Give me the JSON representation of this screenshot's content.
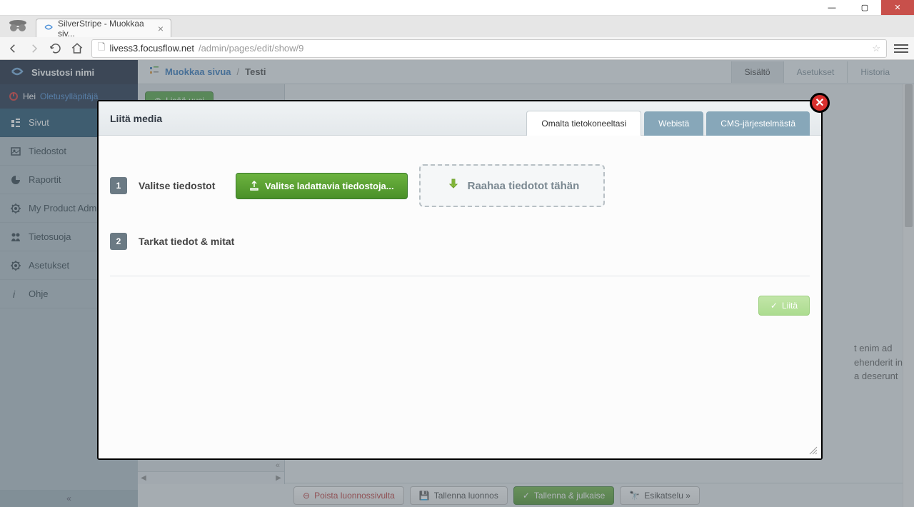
{
  "browser": {
    "tab_title": "SilverStripe - Muokkaa siv...",
    "url_domain": "livess3.focusflow.net",
    "url_path": "/admin/pages/edit/show/9"
  },
  "sidebar": {
    "site_name": "Sivustosi nimi",
    "greeting": "Hei",
    "user": "Oletusylläpitäjä",
    "items": [
      {
        "label": "Sivut"
      },
      {
        "label": "Tiedostot"
      },
      {
        "label": "Raportit"
      },
      {
        "label": "My Product Adm"
      },
      {
        "label": "Tietosuoja"
      },
      {
        "label": "Asetukset"
      },
      {
        "label": "Ohje"
      }
    ],
    "collapse": "«"
  },
  "breadcrumb": {
    "link": "Muokkaa sivua",
    "sep": "/",
    "current": "Testi",
    "tabs": [
      {
        "label": "Sisältö",
        "active": true
      },
      {
        "label": "Asetukset",
        "active": false
      },
      {
        "label": "Historia",
        "active": false
      }
    ]
  },
  "tree": {
    "add_label": "Lisää uusi",
    "collapse": "«"
  },
  "actions": {
    "delete": "Poista luonnossivulta",
    "save_draft": "Tallenna luonnos",
    "publish": "Tallenna & julkaise",
    "preview": "Esikatselu »"
  },
  "modal": {
    "title": "Liitä media",
    "tabs": [
      {
        "label": "Omalta tietokoneeltasi",
        "active": true
      },
      {
        "label": "Webistä",
        "active": false
      },
      {
        "label": "CMS-järjestelmästä",
        "active": false
      }
    ],
    "step1_num": "1",
    "step1_label": "Valitse tiedostot",
    "choose_label": "Valitse ladattavia tiedostoja...",
    "drop_label": "Raahaa tiedotot tähän",
    "step2_num": "2",
    "step2_label": "Tarkat tiedot & mitat",
    "attach_label": "Liitä"
  },
  "content_snippet": {
    "l1": "t enim ad",
    "l2": "ehenderit in",
    "l3": "a deserunt"
  }
}
